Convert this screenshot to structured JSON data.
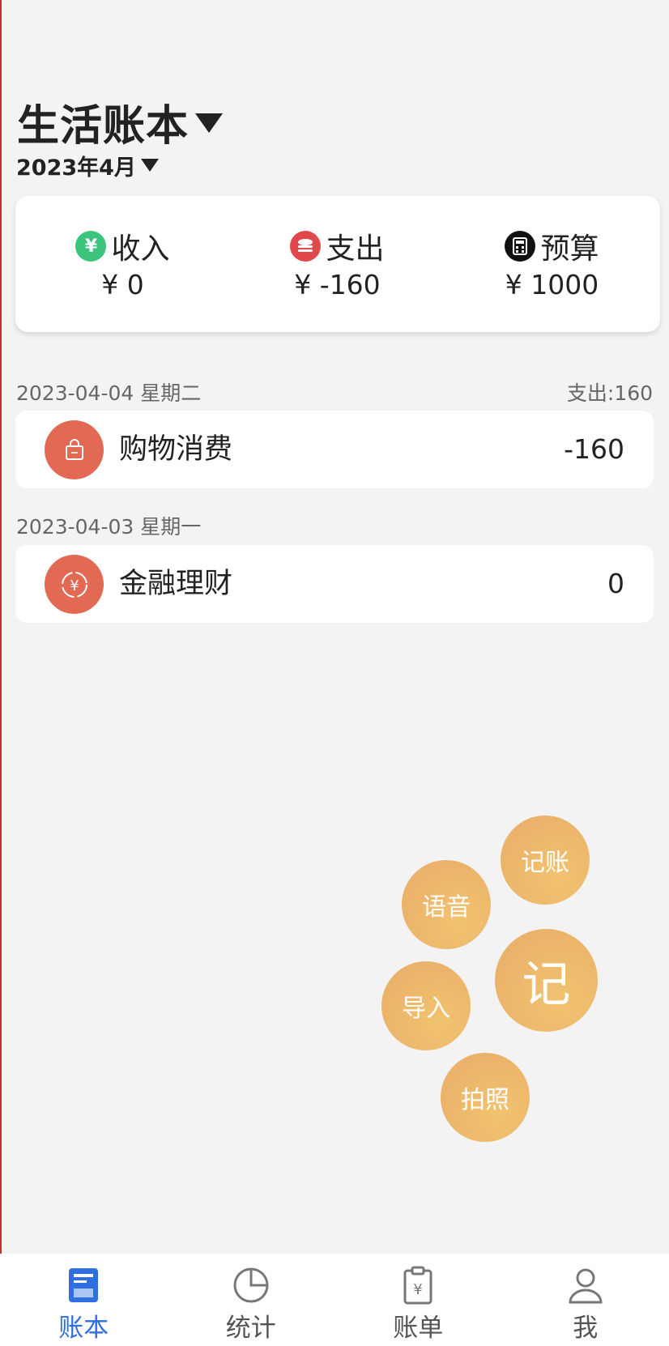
{
  "header": {
    "book_title": "生活账本",
    "month": "2023年4月"
  },
  "summary": {
    "income": {
      "label": "收入",
      "value": "¥ 0",
      "icon": "yuan-icon",
      "color": "#3cc47c"
    },
    "expense": {
      "label": "支出",
      "value": "¥ -160",
      "icon": "coin-stack-icon",
      "color": "#e0484c"
    },
    "budget": {
      "label": "预算",
      "value": "¥ 1000",
      "icon": "calculator-icon",
      "color": "#111111"
    }
  },
  "groups": [
    {
      "date": "2023-04-04 星期二",
      "total": "支出:160",
      "records": [
        {
          "category": "购物消费",
          "amount": "-160",
          "icon": "shopping-bag-icon"
        }
      ]
    },
    {
      "date": "2023-04-03 星期一",
      "records": [
        {
          "category": "金融理财",
          "amount": "0",
          "icon": "finance-yuan-icon"
        }
      ]
    }
  ],
  "fab_menu": {
    "main": "记",
    "record": "记账",
    "voice": "语音",
    "import": "导入",
    "photo": "拍照"
  },
  "nav": {
    "items": [
      {
        "label": "账本",
        "icon": "ledger-icon",
        "active": true
      },
      {
        "label": "统计",
        "icon": "pie-chart-icon",
        "active": false
      },
      {
        "label": "账单",
        "icon": "bill-icon",
        "active": false
      },
      {
        "label": "我",
        "icon": "user-icon",
        "active": false
      }
    ]
  },
  "colors": {
    "accent": "#2f6fe0",
    "fab": "#eeb66b",
    "category": "#e26a55"
  }
}
